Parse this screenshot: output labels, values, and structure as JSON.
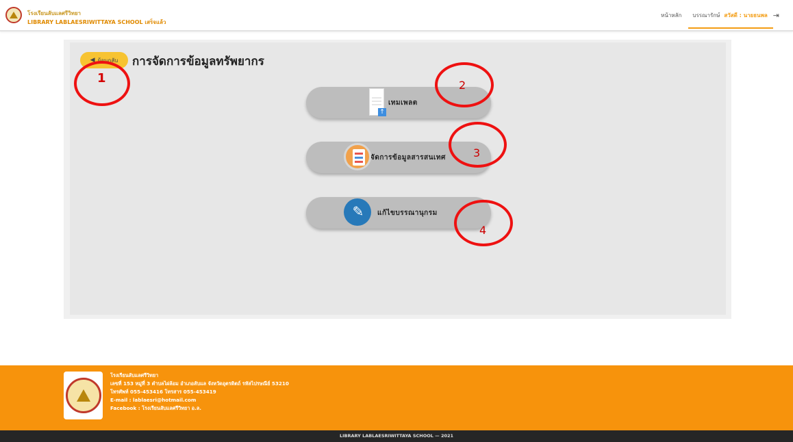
{
  "header": {
    "brand_line1": "โรงเรียนลับแลศรีวิทยา",
    "brand_line2": "LIBRARY LABLAESRIWITTAYA SCHOOL เสร็จแล้ว",
    "nav": {
      "home": "หน้าหลัก",
      "librarian": "บรรณารักษ์",
      "user": "สวัสดี : นายธนพล",
      "logout_icon": "logout-icon"
    }
  },
  "main": {
    "back_label": "ย้อนกลับ",
    "page_title": "การจัดการข้อมูลทรัพยากร",
    "actions": [
      {
        "label": "เทมเพลต",
        "icon": "document-upload-icon"
      },
      {
        "label": "จัดการข้อมูลสารสนเทศ",
        "icon": "resource-data-icon"
      },
      {
        "label": "แก้ไขบรรณานุกรม",
        "icon": "edit-bibliography-icon"
      }
    ]
  },
  "annotations": [
    "1",
    "2",
    "3",
    "4"
  ],
  "footer": {
    "school": "โรงเรียนลับแลศรีวิทยา",
    "address": "เลขที่ 153 หมู่ที่ 3 ตำบลไผ่ล้อม อำเภอลับแล จังหวัดอุตรดิตถ์ รหัสไปรษณีย์ 53210",
    "phone": "โทรศัพท์ 055-453416 โทรสาร 055-453419",
    "email": "E-mail : lablaesri@hotmail.com",
    "facebook": "Facebook : โรงเรียนลับแลศรีวิทยา อ.ล.",
    "copyright": "LIBRARY LABLAESRIWITTAYA SCHOOL — 2021"
  },
  "colors": {
    "accent": "#f39c12",
    "footer": "#f7930c",
    "annotation": "#ee1111"
  }
}
